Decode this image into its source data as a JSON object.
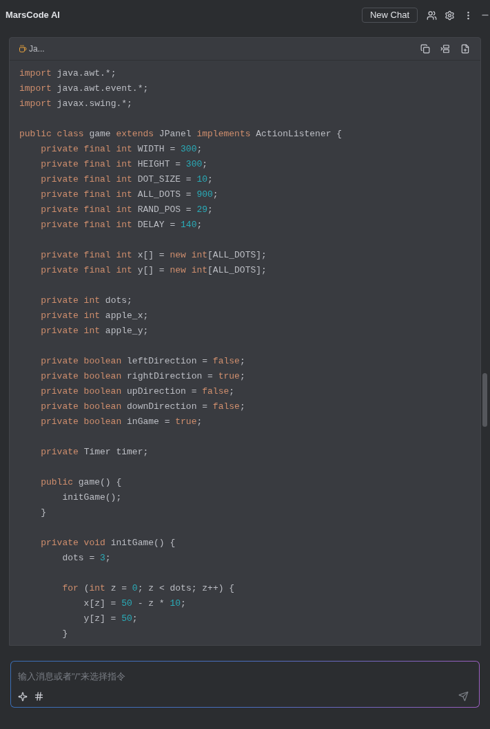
{
  "header": {
    "title": "MarsCode AI",
    "new_chat_label": "New Chat"
  },
  "code_block": {
    "language": "Ja...",
    "lines": [
      {
        "kind": "code",
        "tokens": [
          {
            "kind": "keyword",
            "text": "import"
          },
          {
            "kind": "plain",
            "text": " java.awt.*;"
          }
        ]
      },
      {
        "kind": "code",
        "tokens": [
          {
            "kind": "keyword",
            "text": "import"
          },
          {
            "kind": "plain",
            "text": " java.awt.event.*;"
          }
        ]
      },
      {
        "kind": "code",
        "tokens": [
          {
            "kind": "keyword",
            "text": "import"
          },
          {
            "kind": "plain",
            "text": " javax.swing.*;"
          }
        ]
      },
      {
        "kind": "blank"
      },
      {
        "kind": "code",
        "tokens": [
          {
            "kind": "keyword",
            "text": "public class"
          },
          {
            "kind": "plain",
            "text": " game "
          },
          {
            "kind": "keyword",
            "text": "extends"
          },
          {
            "kind": "plain",
            "text": " JPanel "
          },
          {
            "kind": "keyword",
            "text": "implements"
          },
          {
            "kind": "plain",
            "text": " ActionListener {"
          }
        ]
      },
      {
        "kind": "code",
        "tokens": [
          {
            "kind": "keyword",
            "text": "    private final int"
          },
          {
            "kind": "plain",
            "text": " WIDTH = "
          },
          {
            "kind": "number",
            "text": "300"
          },
          {
            "kind": "plain",
            "text": ";"
          }
        ]
      },
      {
        "kind": "code",
        "tokens": [
          {
            "kind": "keyword",
            "text": "    private final int"
          },
          {
            "kind": "plain",
            "text": " HEIGHT = "
          },
          {
            "kind": "number",
            "text": "300"
          },
          {
            "kind": "plain",
            "text": ";"
          }
        ]
      },
      {
        "kind": "code",
        "tokens": [
          {
            "kind": "keyword",
            "text": "    private final int"
          },
          {
            "kind": "plain",
            "text": " DOT_SIZE = "
          },
          {
            "kind": "number",
            "text": "10"
          },
          {
            "kind": "plain",
            "text": ";"
          }
        ]
      },
      {
        "kind": "code",
        "tokens": [
          {
            "kind": "keyword",
            "text": "    private final int"
          },
          {
            "kind": "plain",
            "text": " ALL_DOTS = "
          },
          {
            "kind": "number",
            "text": "900"
          },
          {
            "kind": "plain",
            "text": ";"
          }
        ]
      },
      {
        "kind": "code",
        "tokens": [
          {
            "kind": "keyword",
            "text": "    private final int"
          },
          {
            "kind": "plain",
            "text": " RAND_POS = "
          },
          {
            "kind": "number",
            "text": "29"
          },
          {
            "kind": "plain",
            "text": ";"
          }
        ]
      },
      {
        "kind": "code",
        "tokens": [
          {
            "kind": "keyword",
            "text": "    private final int"
          },
          {
            "kind": "plain",
            "text": " DELAY = "
          },
          {
            "kind": "number",
            "text": "140"
          },
          {
            "kind": "plain",
            "text": ";"
          }
        ]
      },
      {
        "kind": "blank"
      },
      {
        "kind": "code",
        "tokens": [
          {
            "kind": "keyword",
            "text": "    private final int"
          },
          {
            "kind": "plain",
            "text": " x[] = "
          },
          {
            "kind": "keyword",
            "text": "new int"
          },
          {
            "kind": "plain",
            "text": "[ALL_DOTS];"
          }
        ]
      },
      {
        "kind": "code",
        "tokens": [
          {
            "kind": "keyword",
            "text": "    private final int"
          },
          {
            "kind": "plain",
            "text": " y[] = "
          },
          {
            "kind": "keyword",
            "text": "new int"
          },
          {
            "kind": "plain",
            "text": "[ALL_DOTS];"
          }
        ]
      },
      {
        "kind": "blank"
      },
      {
        "kind": "code",
        "tokens": [
          {
            "kind": "keyword",
            "text": "    private int"
          },
          {
            "kind": "plain",
            "text": " dots;"
          }
        ]
      },
      {
        "kind": "code",
        "tokens": [
          {
            "kind": "keyword",
            "text": "    private int"
          },
          {
            "kind": "plain",
            "text": " apple_x;"
          }
        ]
      },
      {
        "kind": "code",
        "tokens": [
          {
            "kind": "keyword",
            "text": "    private int"
          },
          {
            "kind": "plain",
            "text": " apple_y;"
          }
        ]
      },
      {
        "kind": "blank"
      },
      {
        "kind": "code",
        "tokens": [
          {
            "kind": "keyword",
            "text": "    private boolean"
          },
          {
            "kind": "plain",
            "text": " leftDirection = "
          },
          {
            "kind": "keyword",
            "text": "false"
          },
          {
            "kind": "plain",
            "text": ";"
          }
        ]
      },
      {
        "kind": "code",
        "tokens": [
          {
            "kind": "keyword",
            "text": "    private boolean"
          },
          {
            "kind": "plain",
            "text": " rightDirection = "
          },
          {
            "kind": "keyword",
            "text": "true"
          },
          {
            "kind": "plain",
            "text": ";"
          }
        ]
      },
      {
        "kind": "code",
        "tokens": [
          {
            "kind": "keyword",
            "text": "    private boolean"
          },
          {
            "kind": "plain",
            "text": " upDirection = "
          },
          {
            "kind": "keyword",
            "text": "false"
          },
          {
            "kind": "plain",
            "text": ";"
          }
        ]
      },
      {
        "kind": "code",
        "tokens": [
          {
            "kind": "keyword",
            "text": "    private boolean"
          },
          {
            "kind": "plain",
            "text": " downDirection = "
          },
          {
            "kind": "keyword",
            "text": "false"
          },
          {
            "kind": "plain",
            "text": ";"
          }
        ]
      },
      {
        "kind": "code",
        "tokens": [
          {
            "kind": "keyword",
            "text": "    private boolean"
          },
          {
            "kind": "plain",
            "text": " inGame = "
          },
          {
            "kind": "keyword",
            "text": "true"
          },
          {
            "kind": "plain",
            "text": ";"
          }
        ]
      },
      {
        "kind": "blank"
      },
      {
        "kind": "code",
        "tokens": [
          {
            "kind": "keyword",
            "text": "    private"
          },
          {
            "kind": "plain",
            "text": " Timer timer;"
          }
        ]
      },
      {
        "kind": "blank"
      },
      {
        "kind": "code",
        "tokens": [
          {
            "kind": "keyword",
            "text": "    public"
          },
          {
            "kind": "plain",
            "text": " game() {"
          }
        ]
      },
      {
        "kind": "code",
        "tokens": [
          {
            "kind": "plain",
            "text": "        initGame();"
          }
        ]
      },
      {
        "kind": "code",
        "tokens": [
          {
            "kind": "plain",
            "text": "    }"
          }
        ]
      },
      {
        "kind": "blank"
      },
      {
        "kind": "code",
        "tokens": [
          {
            "kind": "keyword",
            "text": "    private void"
          },
          {
            "kind": "plain",
            "text": " initGame() {"
          }
        ]
      },
      {
        "kind": "code",
        "tokens": [
          {
            "kind": "plain",
            "text": "        dots = "
          },
          {
            "kind": "number",
            "text": "3"
          },
          {
            "kind": "plain",
            "text": ";"
          }
        ]
      },
      {
        "kind": "blank"
      },
      {
        "kind": "code",
        "tokens": [
          {
            "kind": "keyword",
            "text": "        for"
          },
          {
            "kind": "plain",
            "text": " ("
          },
          {
            "kind": "keyword",
            "text": "int"
          },
          {
            "kind": "plain",
            "text": " z = "
          },
          {
            "kind": "number",
            "text": "0"
          },
          {
            "kind": "plain",
            "text": "; z < dots; z++) {"
          }
        ]
      },
      {
        "kind": "code",
        "tokens": [
          {
            "kind": "plain",
            "text": "            x[z] = "
          },
          {
            "kind": "number",
            "text": "50"
          },
          {
            "kind": "plain",
            "text": " - z * "
          },
          {
            "kind": "number",
            "text": "10"
          },
          {
            "kind": "plain",
            "text": ";"
          }
        ]
      },
      {
        "kind": "code",
        "tokens": [
          {
            "kind": "plain",
            "text": "            y[z] = "
          },
          {
            "kind": "number",
            "text": "50"
          },
          {
            "kind": "plain",
            "text": ";"
          }
        ]
      },
      {
        "kind": "code",
        "tokens": [
          {
            "kind": "plain",
            "text": "        }"
          }
        ]
      }
    ]
  },
  "input": {
    "placeholder": "输入消息或者\"/\"来选择指令"
  }
}
